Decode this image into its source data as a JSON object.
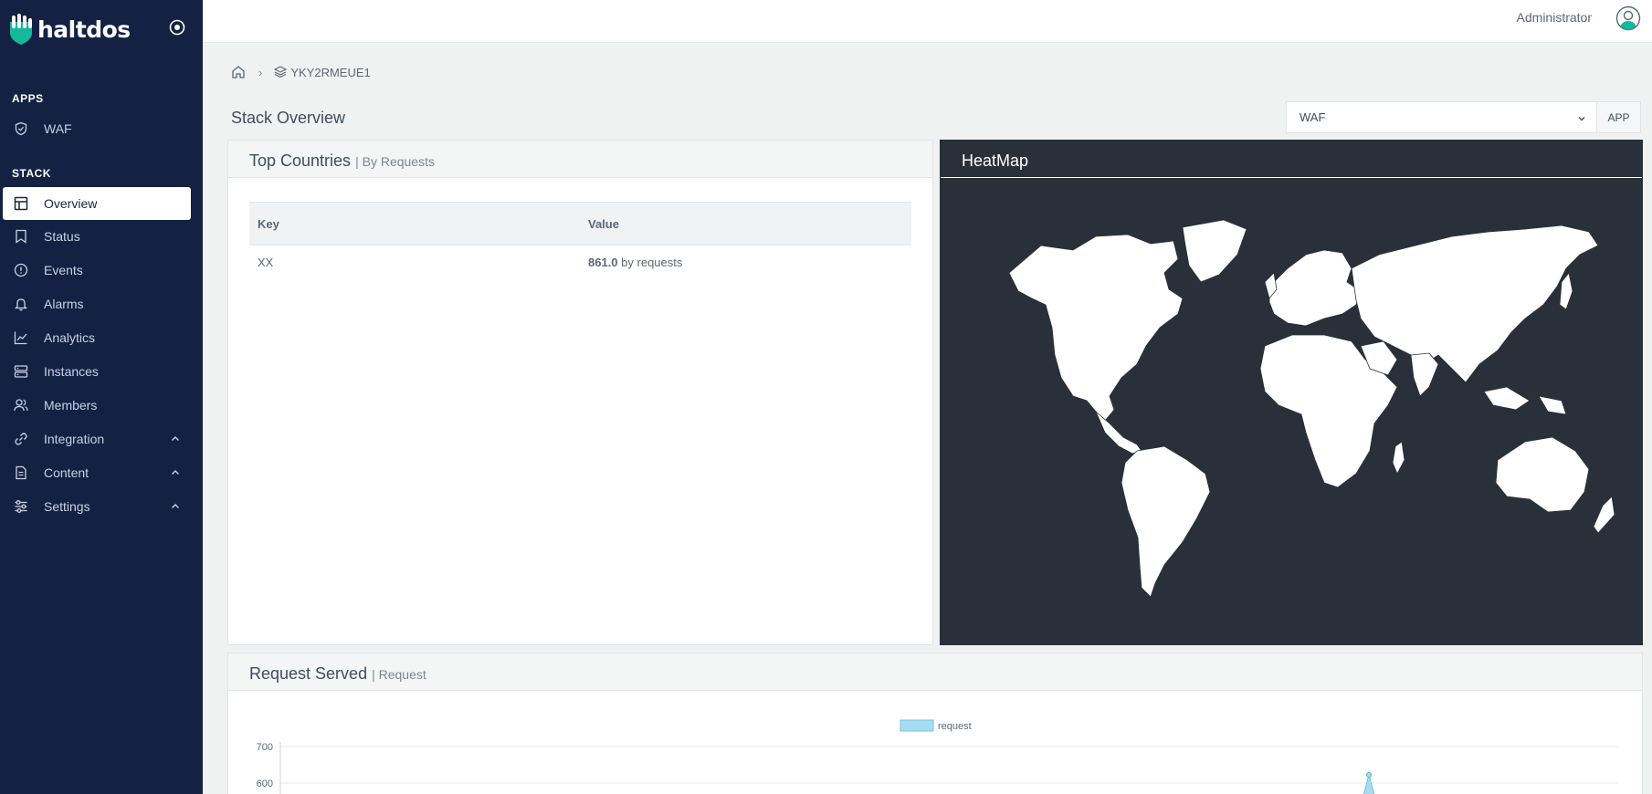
{
  "brand": {
    "name": "haltdos"
  },
  "sidebar": {
    "sections": {
      "apps": "APPS",
      "stack": "STACK"
    },
    "apps_items": [
      {
        "label": "WAF",
        "icon": "shield-check-icon"
      }
    ],
    "stack_items": [
      {
        "label": "Overview",
        "icon": "layout-icon",
        "active": true
      },
      {
        "label": "Status",
        "icon": "bookmark-icon"
      },
      {
        "label": "Events",
        "icon": "alert-circle-icon"
      },
      {
        "label": "Alarms",
        "icon": "bell-icon"
      },
      {
        "label": "Analytics",
        "icon": "line-chart-icon"
      },
      {
        "label": "Instances",
        "icon": "server-icon"
      },
      {
        "label": "Members",
        "icon": "users-icon"
      },
      {
        "label": "Integration",
        "icon": "link-icon",
        "expandable": true
      },
      {
        "label": "Content",
        "icon": "file-text-icon",
        "expandable": true
      },
      {
        "label": "Settings",
        "icon": "sliders-icon",
        "expandable": true
      }
    ]
  },
  "topbar": {
    "user": "Administrator"
  },
  "breadcrumb": {
    "stack": "YKY2RMEUE1"
  },
  "page": {
    "title": "Stack Overview",
    "app_select": {
      "value": "WAF",
      "button": "APP"
    }
  },
  "top_countries": {
    "title": "Top Countries",
    "subtitle": "| By Requests",
    "columns": [
      "Key",
      "Value"
    ],
    "rows": [
      {
        "key": "XX",
        "value": "861.0",
        "unit": "by requests"
      }
    ]
  },
  "heatmap": {
    "title": "HeatMap"
  },
  "request_served": {
    "title": "Request Served",
    "subtitle": "| Request"
  },
  "chart_data": {
    "type": "line",
    "series": [
      {
        "name": "request",
        "color": "#a8dcf0"
      }
    ],
    "y_ticks": [
      "700",
      "600"
    ],
    "ylim": [
      0,
      700
    ],
    "grid": true,
    "legend": "top-center"
  },
  "colors": {
    "sidebar_bg": "#142143",
    "heatmap_bg": "#2a303a",
    "accent_teal": "#14b89c"
  }
}
